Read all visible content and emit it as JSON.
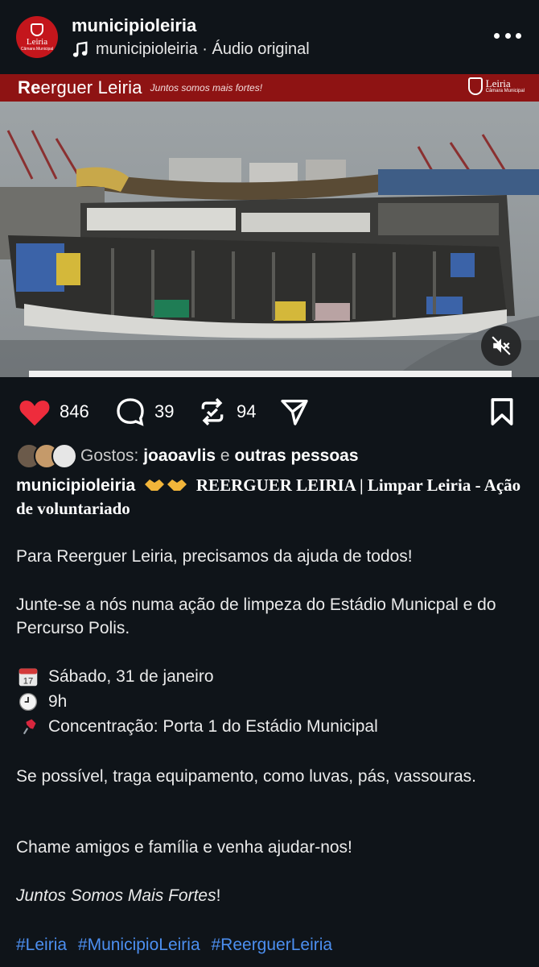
{
  "header": {
    "username": "municipioleiria",
    "audio_owner": "municipioleiria",
    "audio_separator": " · ",
    "audio_label": "Áudio original",
    "avatar_brand": "Leiria",
    "avatar_sub": "Câmara Municipal"
  },
  "media": {
    "banner_title_bold": "Re",
    "banner_title_rest": "erguer Leiria",
    "banner_slogan": "Juntos somos mais fortes!",
    "logo_name": "Leiria",
    "logo_sub": "Câmara Municipal"
  },
  "actions": {
    "likes": "846",
    "comments": "39",
    "reposts": "94"
  },
  "likes_line": {
    "prefix": "Gostos: ",
    "user": "joaoavlis",
    "connector": " e ",
    "others": "outras pessoas"
  },
  "caption": {
    "user": "municipioleiria",
    "title": "REERGUER LEIRIA | Limpar Leiria - Ação de voluntariado",
    "p1": "Para Reerguer Leiria, precisamos da ajuda de todos!",
    "p2": "Junte-se a nós numa ação de limpeza do Estádio Municpal e do Percurso Polis.",
    "date": "Sábado, 31 de janeiro",
    "time": "9h",
    "place": "Concentração: Porta 1 do Estádio Municipal",
    "p3": "Se possível, traga equipamento, como luvas, pás, vassouras.",
    "p4": "Chame amigos e família e venha ajudar-nos!",
    "slogan_italic": "Juntos Somos Mais Fortes",
    "slogan_end": "!",
    "calendar_day": "17",
    "hashtags": [
      "#Leiria",
      "#MunicipioLeiria",
      "#ReerguerLeiria"
    ]
  },
  "colors": {
    "background": "#0f1419",
    "brand_red": "#c4161c",
    "banner_red": "#8e1313",
    "like_red": "#ee2c3c",
    "hashtag_blue": "#4c8ff0"
  },
  "icons": [
    "avatar",
    "music-note-icon",
    "more-icon",
    "mute-icon",
    "heart-icon",
    "comment-icon",
    "repost-icon",
    "share-icon",
    "bookmark-icon",
    "calendar-icon",
    "clock-icon",
    "pushpin-icon",
    "handshake-icon"
  ]
}
